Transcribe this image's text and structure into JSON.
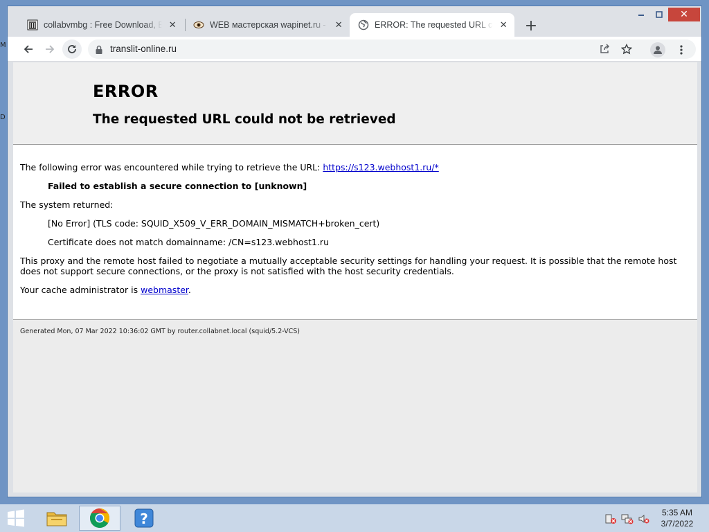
{
  "desktop": {
    "edge_top": "M",
    "edge_mid": "D"
  },
  "browser": {
    "tabs": [
      {
        "title": "collabvmbg : Free Download, Bo",
        "icon": "archive-icon",
        "active": false
      },
      {
        "title": "WEB мастерская wapinet.ru - Sc",
        "icon": "eye-favicon-icon",
        "active": false
      },
      {
        "title": "ERROR: The requested URL could",
        "icon": "globe-icon",
        "active": true
      }
    ],
    "new_tab": "+",
    "address": "translit-online.ru"
  },
  "page": {
    "heading": "ERROR",
    "subheading": "The requested URL could not be retrieved",
    "intro": "The following error was encountered while trying to retrieve the URL: ",
    "url_link": "https://s123.webhost1.ru/*",
    "failed": "Failed to establish a secure connection to [unknown]",
    "system_returned": "The system returned:",
    "error_code": "[No Error] (TLS code: SQUID_X509_V_ERR_DOMAIN_MISMATCH+broken_cert)",
    "cert_detail": "Certificate does not match domainname: /CN=s123.webhost1.ru",
    "explanation": "This proxy and the remote host failed to negotiate a mutually acceptable security settings for handling your request. It is possible that the remote host does not support secure connections, or the proxy is not satisfied with the host security credentials.",
    "admin_prefix": "Your cache administrator is ",
    "admin_link": "webmaster",
    "admin_suffix": ".",
    "footer": "Generated Mon, 07 Mar 2022 10:36:02 GMT by router.collabnet.local (squid/5.2-VCS)"
  },
  "taskbar": {
    "apps": [
      "file-explorer-icon",
      "chrome-icon",
      "help-icon"
    ],
    "clock_time": "5:35 AM",
    "clock_date": "3/7/2022"
  },
  "colors": {
    "link": "#0000cc",
    "close_button": "#c7463c",
    "taskbar": "#c9d7e8"
  }
}
